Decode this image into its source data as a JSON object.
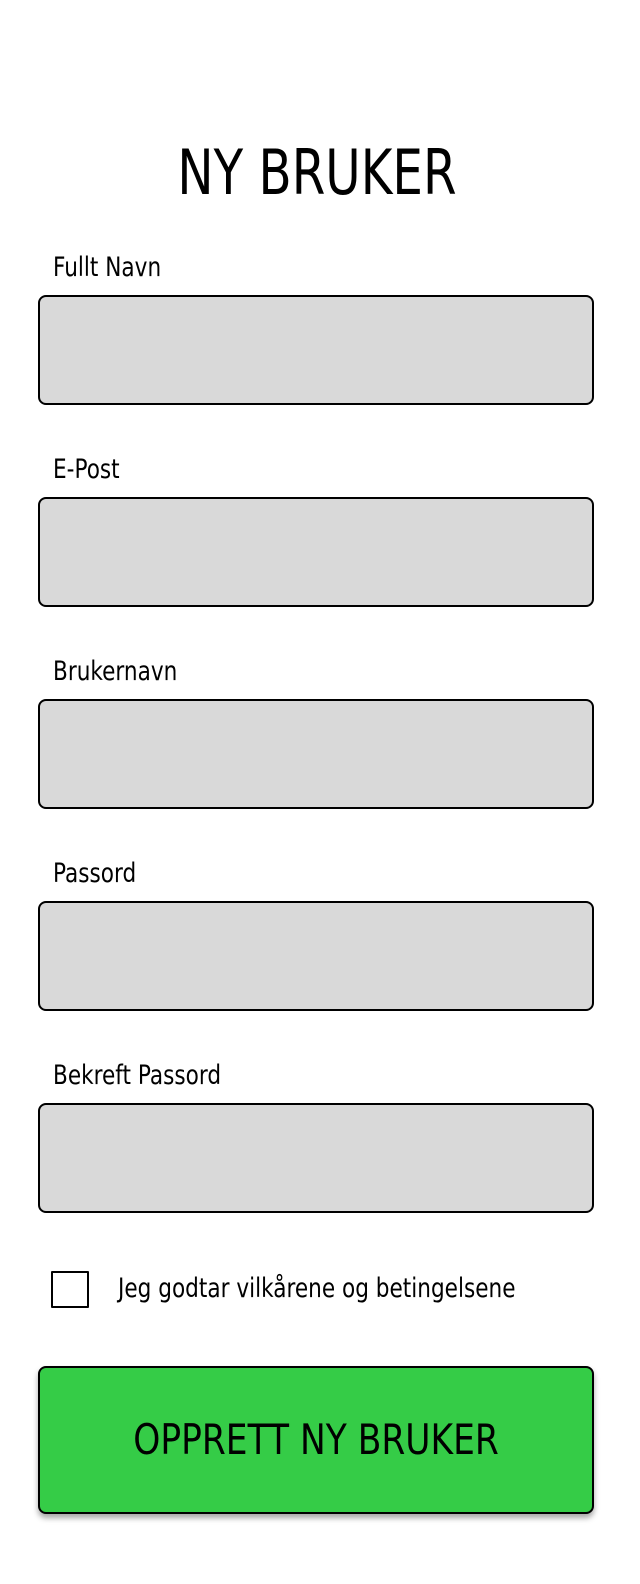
{
  "form": {
    "title": "NY BRUKER",
    "fields": [
      {
        "label": "Fullt Navn",
        "value": "",
        "placeholder": ""
      },
      {
        "label": "E-Post",
        "value": "",
        "placeholder": ""
      },
      {
        "label": "Brukernavn",
        "value": "",
        "placeholder": ""
      },
      {
        "label": "Passord",
        "value": "",
        "placeholder": ""
      },
      {
        "label": "Bekreft Passord",
        "value": "",
        "placeholder": ""
      }
    ],
    "terms": {
      "label": "Jeg godtar vilkårene og betingelsene",
      "checked": false
    },
    "submit_label": "OPPRETT NY BRUKER"
  },
  "colors": {
    "background": "#ffffff",
    "input_fill": "#d9d9d9",
    "border": "#000000",
    "button_fill": "#35cc47",
    "text": "#000000"
  }
}
